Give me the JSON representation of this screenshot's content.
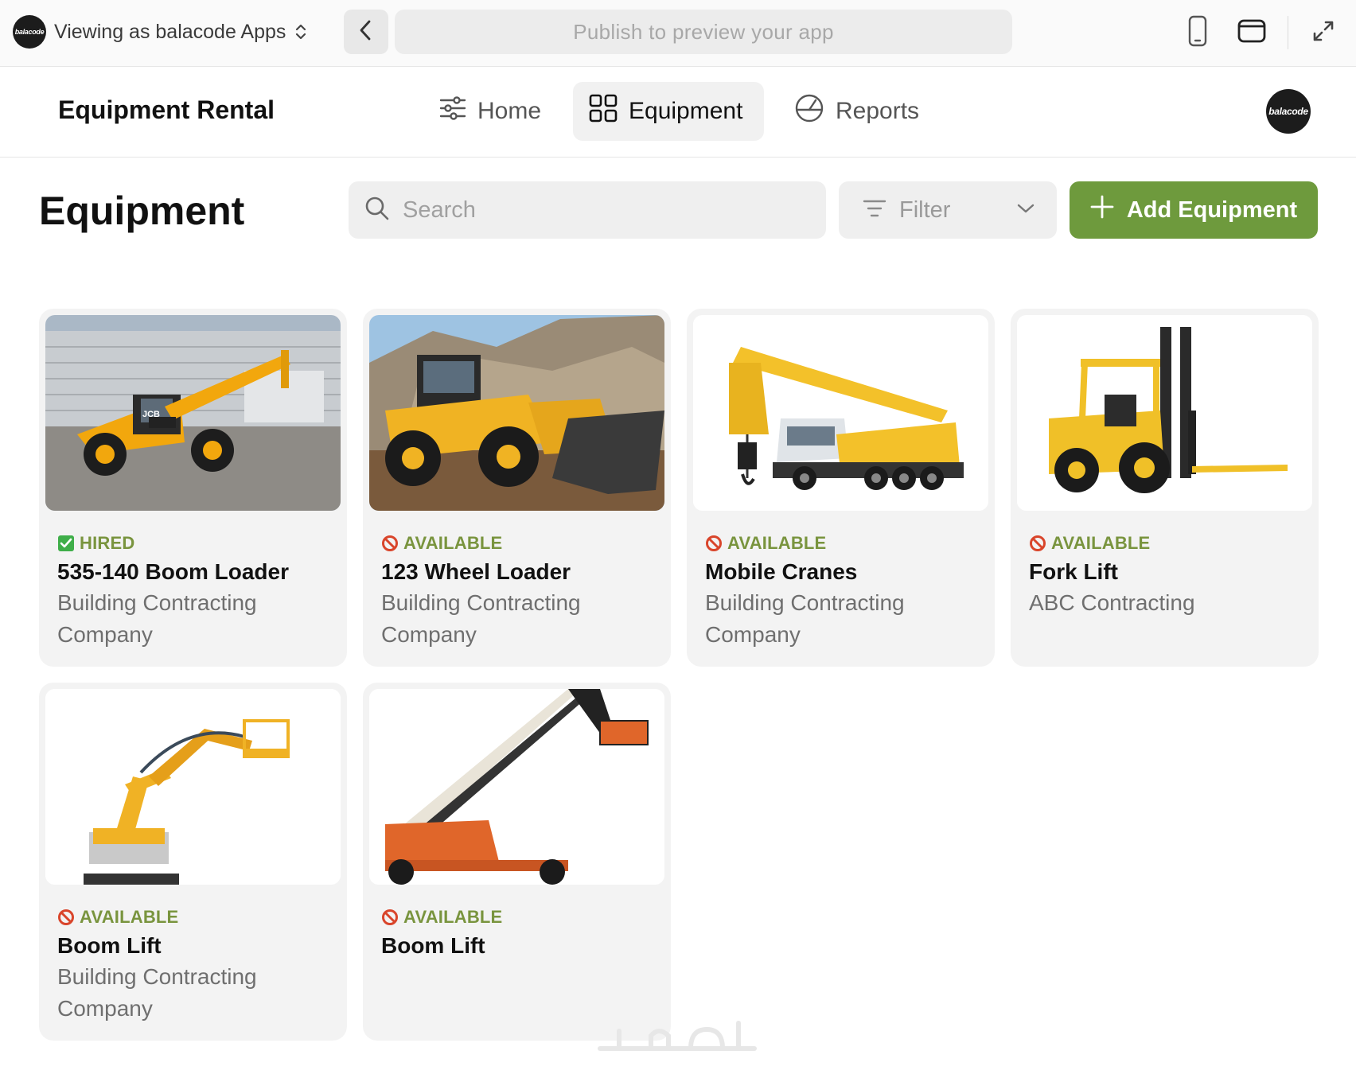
{
  "topbar": {
    "logo_text": "balacode",
    "viewing_label": "Viewing as balacode Apps",
    "url_placeholder": "Publish to preview your app"
  },
  "app": {
    "title": "Equipment Rental",
    "nav": [
      {
        "label": "Home",
        "icon": "sliders-icon"
      },
      {
        "label": "Equipment",
        "icon": "grid-icon",
        "active": true
      },
      {
        "label": "Reports",
        "icon": "gauge-icon"
      }
    ],
    "avatar_text": "balacode"
  },
  "page": {
    "title": "Equipment",
    "search_placeholder": "Search",
    "filter_label": "Filter",
    "add_button_label": "Add Equipment"
  },
  "colors": {
    "accent_green": "#6e9a3d",
    "status_text": "#79943e",
    "hired_check": "#3fae49",
    "available_icon": "#d9452b"
  },
  "equipment": [
    {
      "status": "HIRED",
      "status_icon": "check-icon",
      "name": "535-140 Boom Loader",
      "company": "Building Contracting Company",
      "image": "telehandler"
    },
    {
      "status": "AVAILABLE",
      "status_icon": "prohibited-icon",
      "name": "123 Wheel Loader",
      "company": "Building Contracting Company",
      "image": "wheel-loader"
    },
    {
      "status": "AVAILABLE",
      "status_icon": "prohibited-icon",
      "name": "Mobile Cranes",
      "company": "Building Contracting Company",
      "image": "mobile-crane"
    },
    {
      "status": "AVAILABLE",
      "status_icon": "prohibited-icon",
      "name": "Fork Lift",
      "company": "ABC Contracting",
      "image": "forklift"
    },
    {
      "status": "AVAILABLE",
      "status_icon": "prohibited-icon",
      "name": "Boom Lift",
      "company": "Building Contracting Company",
      "image": "articulating-boom-lift"
    },
    {
      "status": "AVAILABLE",
      "status_icon": "prohibited-icon",
      "name": "Boom Lift",
      "company": "",
      "image": "telescopic-boom-lift"
    }
  ]
}
